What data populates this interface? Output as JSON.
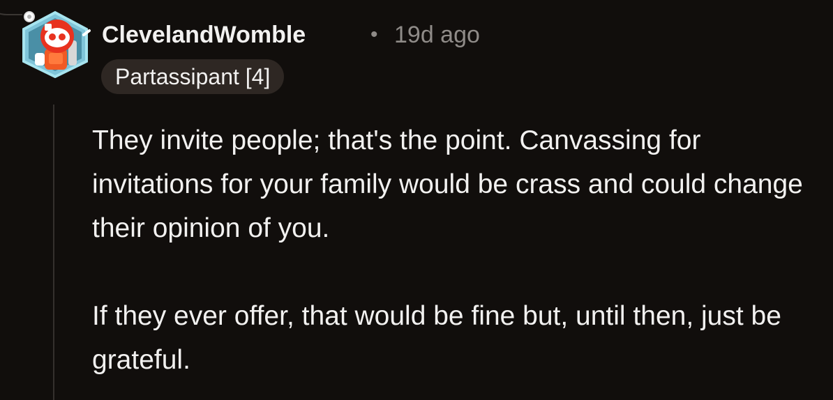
{
  "comment": {
    "author": "ClevelandWomble",
    "separator": "•",
    "time_ago": "19d ago",
    "flair": "Partassipant [4]",
    "avatar_icon": "snoo-robot-avatar-icon",
    "paragraphs": [
      "They invite people; that's the point. Canvassing for invitations for your family would be crass and could change their opinion of you.",
      "If they ever offer, that would be fine but, until then, just be grateful."
    ]
  },
  "colors": {
    "background": "#110e0c",
    "text": "#f2f1f0",
    "muted": "#8f8b88",
    "flair_bg": "#2e2723",
    "thread_line": "#34302d"
  }
}
